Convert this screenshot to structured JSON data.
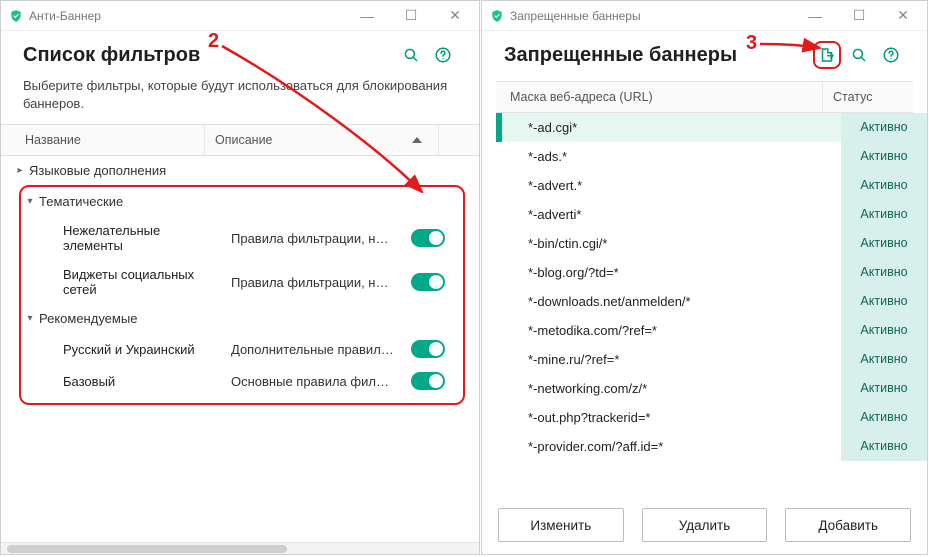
{
  "annotations": {
    "num2": "2",
    "num3": "3"
  },
  "left": {
    "window_title": "Анти-Баннер",
    "header_title": "Список фильтров",
    "subtitle": "Выберите фильтры, которые будут использоваться для блокирования баннеров.",
    "columns": {
      "name": "Название",
      "desc": "Описание"
    },
    "group_lang": "Языковые дополнения",
    "group_theme": "Тематические",
    "group_rec": "Рекомендуемые",
    "filters": {
      "theme": [
        {
          "name": "Нежелательные элементы",
          "desc": "Правила фильтрации, не…"
        },
        {
          "name": "Виджеты социальных сетей",
          "desc": "Правила фильтрации, не…"
        }
      ],
      "rec": [
        {
          "name": "Русский и Украинский",
          "desc": "Дополнительные правил…"
        },
        {
          "name": "Базовый",
          "desc": "Основные правила филь…"
        }
      ]
    }
  },
  "right": {
    "window_title": "Запрещенные баннеры",
    "header_title": "Запрещенные баннеры",
    "columns": {
      "url": "Маска веб-адреса (URL)",
      "status": "Статус"
    },
    "status_label": "Активно",
    "rows": [
      "*-ad.cgi*",
      "*-ads.*",
      "*-advert.*",
      "*-adverti*",
      "*-bin/ctin.cgi/*",
      "*-blog.org/?td=*",
      "*-downloads.net/anmelden/*",
      "*-metodika.com/?ref=*",
      "*-mine.ru/?ref=*",
      "*-networking.com/z/*",
      "*-out.php?trackerid=*",
      "*-provider.com/?aff.id=*"
    ],
    "buttons": {
      "edit": "Изменить",
      "delete": "Удалить",
      "add": "Добавить"
    }
  }
}
